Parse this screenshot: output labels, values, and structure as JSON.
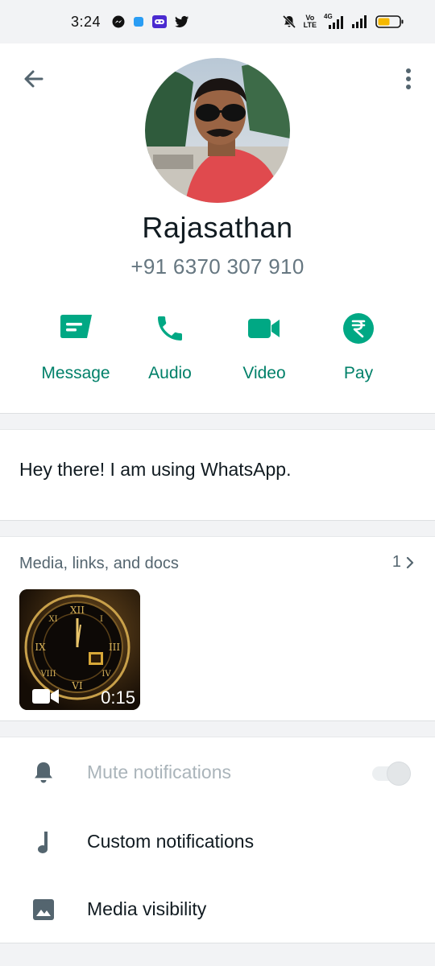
{
  "status_bar": {
    "time": "3:24",
    "volte_top": "Vo",
    "volte_bottom": "LTE",
    "network": "4G"
  },
  "contact": {
    "name": "Rajasathan",
    "phone": "+91 6370 307 910",
    "about": "Hey there! I am using WhatsApp."
  },
  "actions": [
    {
      "label": "Message",
      "icon": "message-icon"
    },
    {
      "label": "Audio",
      "icon": "phone-icon"
    },
    {
      "label": "Video",
      "icon": "videocam-icon"
    },
    {
      "label": "Pay",
      "icon": "rupee-icon"
    }
  ],
  "media": {
    "title": "Media, links, and docs",
    "count": "1",
    "items": [
      {
        "type": "video",
        "duration": "0:15",
        "icon": "videocam-icon"
      }
    ]
  },
  "settings": [
    {
      "label": "Mute notifications",
      "icon": "bell-icon",
      "enabled": false
    },
    {
      "label": "Custom notifications",
      "icon": "music-note-icon"
    },
    {
      "label": "Media visibility",
      "icon": "image-icon"
    }
  ],
  "colors": {
    "accent": "#008069",
    "text_primary": "#111b21",
    "text_secondary": "#667781",
    "background": "#f2f3f5"
  }
}
